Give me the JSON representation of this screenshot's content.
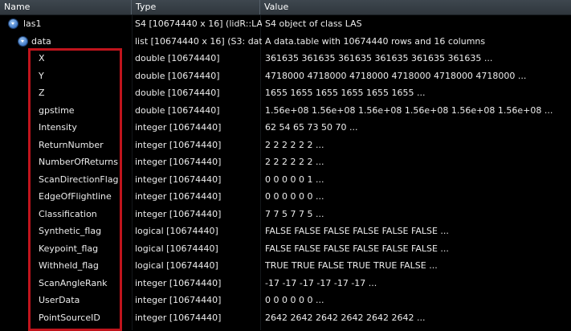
{
  "header": {
    "name": "Name",
    "type": "Type",
    "value": "Value"
  },
  "root": {
    "name": "las1",
    "type": "S4 [10674440 x 16] (lidR::LA",
    "value": "S4 object of class LAS"
  },
  "data_node": {
    "name": "data",
    "type": "list [10674440 x 16] (S3: dat",
    "value": "A data.table with 10674440 rows and 16 columns"
  },
  "fields": [
    {
      "name": "X",
      "type": "double [10674440]",
      "value": "361635 361635 361635 361635 361635 361635 ..."
    },
    {
      "name": "Y",
      "type": "double [10674440]",
      "value": "4718000 4718000 4718000 4718000 4718000 4718000 ..."
    },
    {
      "name": "Z",
      "type": "double [10674440]",
      "value": "1655 1655 1655 1655 1655 1655 ..."
    },
    {
      "name": "gpstime",
      "type": "double [10674440]",
      "value": "1.56e+08 1.56e+08 1.56e+08 1.56e+08 1.56e+08 1.56e+08 ..."
    },
    {
      "name": "Intensity",
      "type": "integer [10674440]",
      "value": "62 54 65 73 50 70 ..."
    },
    {
      "name": "ReturnNumber",
      "type": "integer [10674440]",
      "value": "2 2 2 2 2 2 ..."
    },
    {
      "name": "NumberOfReturns",
      "type": "integer [10674440]",
      "value": "2 2 2 2 2 2 ..."
    },
    {
      "name": "ScanDirectionFlag",
      "type": "integer [10674440]",
      "value": "0 0 0 0 0 1 ..."
    },
    {
      "name": "EdgeOfFlightline",
      "type": "integer [10674440]",
      "value": "0 0 0 0 0 0 ..."
    },
    {
      "name": "Classification",
      "type": "integer [10674440]",
      "value": "7 7 5 7 7 5 ..."
    },
    {
      "name": "Synthetic_flag",
      "type": "logical [10674440]",
      "value": "FALSE FALSE FALSE FALSE FALSE FALSE ..."
    },
    {
      "name": "Keypoint_flag",
      "type": "logical [10674440]",
      "value": "FALSE FALSE FALSE FALSE FALSE FALSE ..."
    },
    {
      "name": "Withheld_flag",
      "type": "logical [10674440]",
      "value": "TRUE TRUE FALSE TRUE TRUE FALSE ..."
    },
    {
      "name": "ScanAngleRank",
      "type": "integer [10674440]",
      "value": "-17 -17 -17 -17 -17 -17 ..."
    },
    {
      "name": "UserData",
      "type": "integer [10674440]",
      "value": "0 0 0 0 0 0 ..."
    },
    {
      "name": "PointSourceID",
      "type": "integer [10674440]",
      "value": "2642 2642 2642 2642 2642 2642 ..."
    }
  ],
  "colors": {
    "background": "#000000",
    "highlight_box": "#c0141c",
    "toggle": "#3f78c6"
  }
}
